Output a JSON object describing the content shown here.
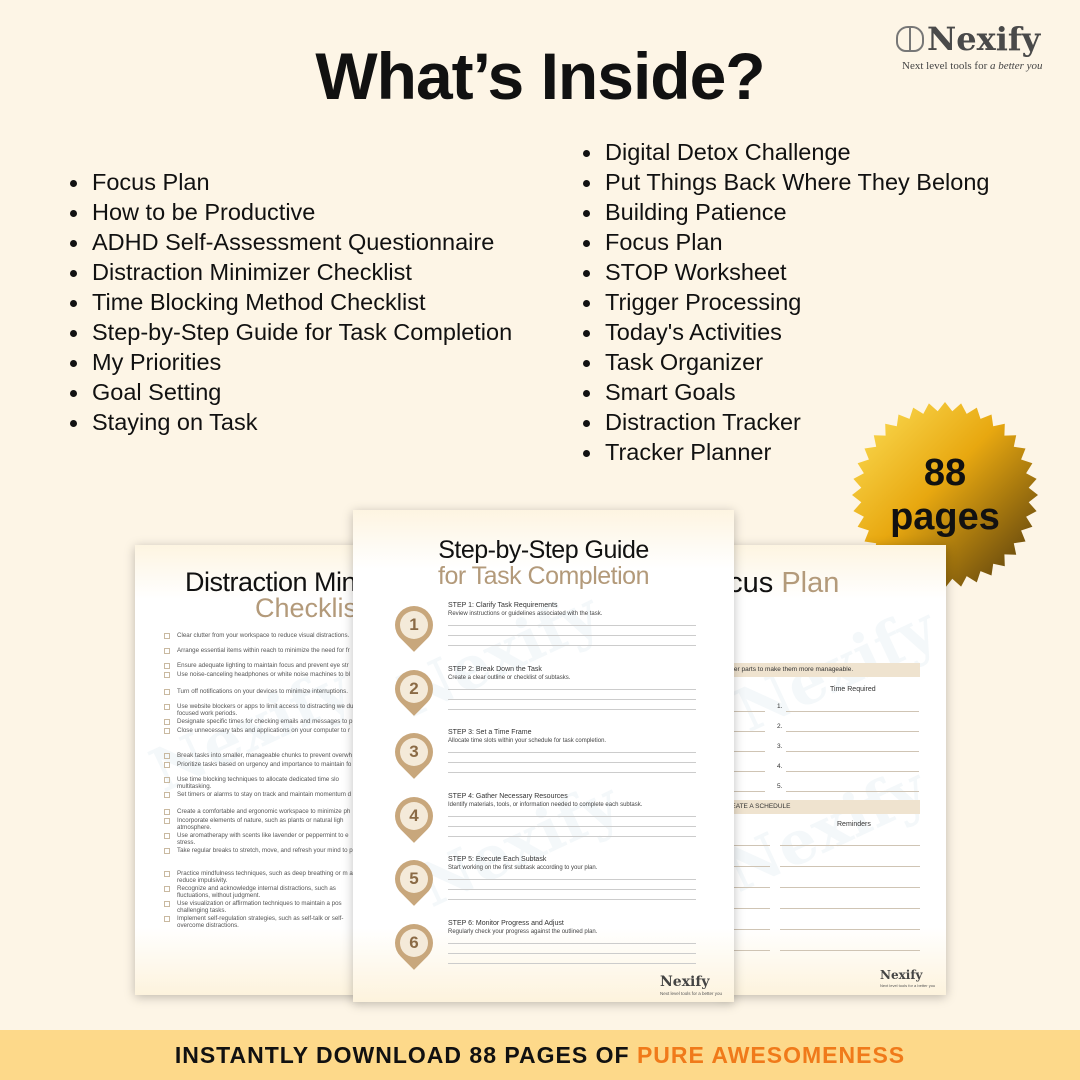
{
  "header": {
    "title": "What’s Inside?"
  },
  "logo": {
    "name": "Nexify",
    "tagline_plain": "Next level tools for ",
    "tagline_italic": "a better you"
  },
  "list_left": [
    "Focus Plan",
    "How to be Productive",
    "ADHD Self-Assessment Questionnaire",
    "Distraction Minimizer Checklist",
    "Time Blocking Method Checklist",
    "Step-by-Step Guide for Task Completion",
    "My Priorities",
    "Goal Setting",
    "Staying on Task"
  ],
  "list_right": [
    "Digital Detox Challenge",
    "Put Things Back Where They Belong",
    "Building Patience",
    "Focus Plan",
    "STOP Worksheet",
    "Trigger Processing",
    "Today's Activities",
    "Task Organizer",
    "Smart Goals",
    "Distraction Tracker",
    "Tracker Planner"
  ],
  "badge": {
    "number": "88",
    "unit": "pages",
    "colors": [
      "#f7c21a",
      "#b07d1f",
      "#3a2a0e"
    ]
  },
  "left_page": {
    "title": "Distraction Min",
    "subtitle": "Checklist",
    "groups": [
      [
        "Clear clutter from your workspace to reduce visual distractions.",
        "Arrange essential items within reach to minimize the need for fr",
        "Ensure adequate lighting to maintain focus and prevent eye str",
        "Use noise-canceling headphones or white noise machines to bl"
      ],
      [
        "Turn off notifications on your devices to minimize interruptions.",
        "Use website blockers or apps to limit access to distracting we during focused work periods.",
        "Designate specific times for checking emails and messages to p",
        "Close unnecessary tabs and applications on your computer to r"
      ],
      [
        "Break tasks into smaller, manageable chunks to prevent overwh",
        "Prioritize tasks based on urgency and importance to maintain fo",
        "Use time blocking techniques to allocate dedicated time slo multitasking.",
        "Set timers or alarms to stay on track and maintain momentum d"
      ],
      [
        "Create a comfortable and ergonomic workspace to minimize ph",
        "Incorporate elements of nature, such as plants or natural ligh atmosphere.",
        "Use aromatherapy with scents like lavender or peppermint to e stress.",
        "Take regular breaks to stretch, move, and refresh your mind to p"
      ],
      [
        "Practice mindfulness techniques, such as deep breathing or m and reduce impulsivity.",
        "Recognize and acknowledge internal distractions, such as fluctuations, without judgment.",
        "Use visualization or affirmation techniques to maintain a pos challenging tasks.",
        "Implement self-regulation strategies, such as self-talk or self- overcome distractions."
      ]
    ]
  },
  "center_page": {
    "title": "Step-by-Step Guide",
    "subtitle": "for Task Completion",
    "steps": [
      {
        "n": "1",
        "title": "STEP 1: Clarify Task Requirements",
        "desc": "Review instructions or guidelines associated with the task."
      },
      {
        "n": "2",
        "title": "STEP 2: Break Down the Task",
        "desc": "Create a clear outline or checklist of subtasks."
      },
      {
        "n": "3",
        "title": "STEP 3: Set a Time Frame",
        "desc": "Allocate time slots within your schedule for task completion."
      },
      {
        "n": "4",
        "title": "STEP 4: Gather Necessary Resources",
        "desc": "Identify materials, tools, or information needed to complete each subtask."
      },
      {
        "n": "5",
        "title": "STEP 5: Execute Each Subtask",
        "desc": "Start working on the first subtask according to your plan."
      },
      {
        "n": "6",
        "title": "STEP 6: Monitor Progress and Adjust",
        "desc": "Regularly check your progress against the outlined plan."
      }
    ],
    "footer_logo": "Nexify",
    "footer_tag": "Next level tools for a better you"
  },
  "right_page": {
    "title_dark": "ocus",
    "title_accent": "Plan",
    "band1": "maller parts to make them more manageable.",
    "time_required": "Time Required",
    "numbers": [
      "1.",
      "2.",
      "3.",
      "4.",
      "5."
    ],
    "band2": "CREATE A SCHEDULE",
    "reminders": "Reminders",
    "footer_logo": "Nexify",
    "footer_tag": "Next level tools for a better you"
  },
  "watermark": {
    "name": "Nexify",
    "tagline": "Next level tools for a better you"
  },
  "bottom_bar": {
    "text": "INSTANTLY DOWNLOAD 88 PAGES OF ",
    "highlight": "PURE AWESOMENESS",
    "accent_color": "#f07a1a"
  }
}
